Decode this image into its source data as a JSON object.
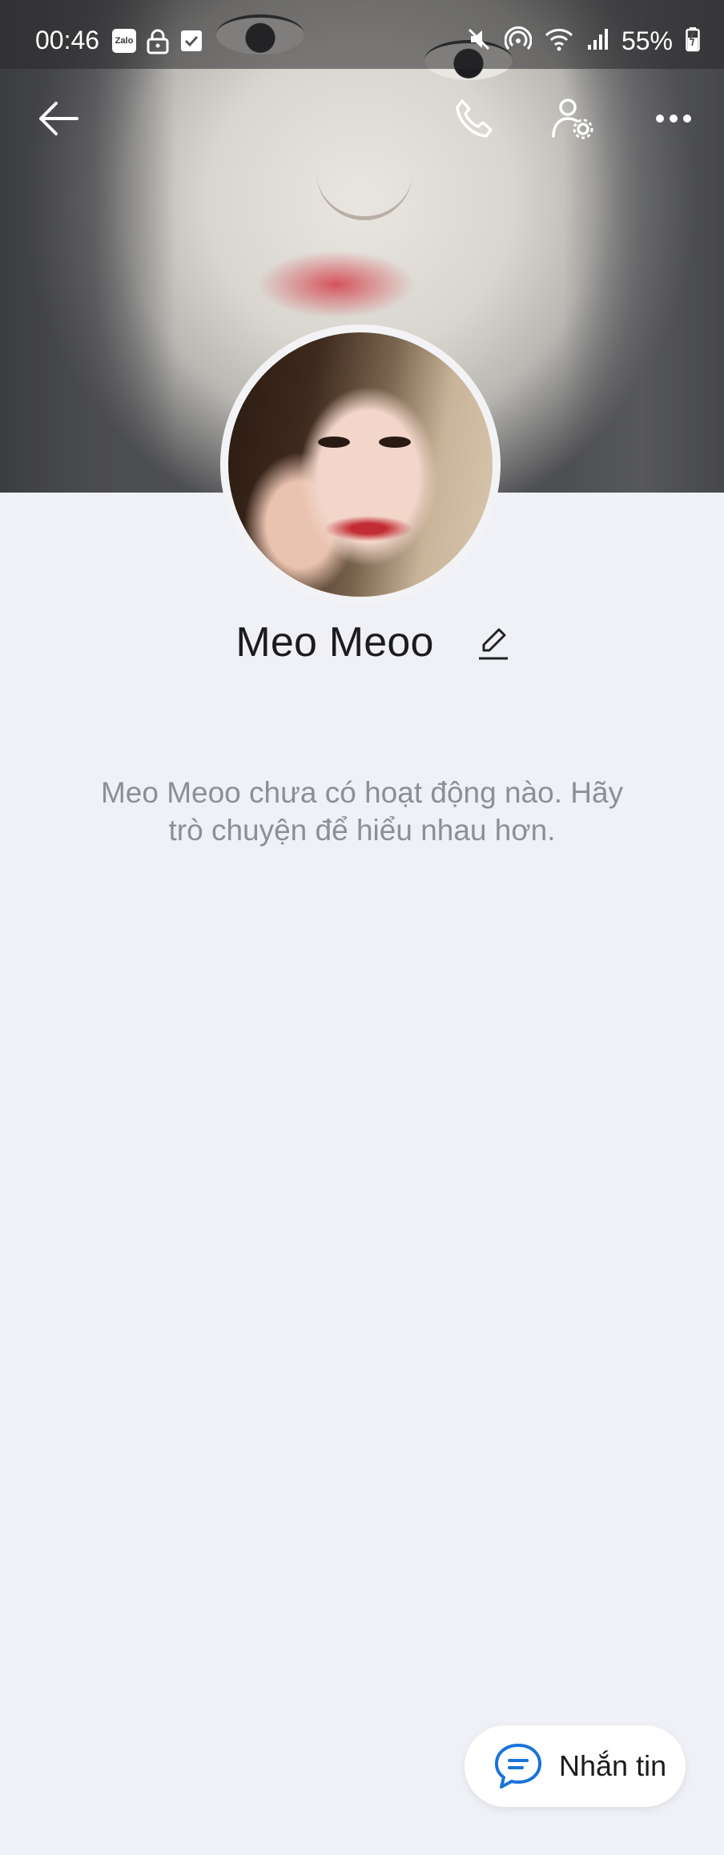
{
  "status_bar": {
    "time": "00:46",
    "left_icons": [
      "zalo-app-icon",
      "lock-icon",
      "checkbox-icon"
    ],
    "zalo_badge": "Zalo",
    "right_icons": [
      "mute-icon",
      "hotspot-icon",
      "wifi-icon",
      "signal-icon"
    ],
    "battery": "55%"
  },
  "top_bar": {
    "icons": [
      "back-arrow-icon",
      "phone-icon",
      "user-settings-icon",
      "more-icon"
    ]
  },
  "profile": {
    "name": "Meo Meoo",
    "edit_icon": "pencil-icon",
    "empty_message": "Meo Meoo chưa có hoạt động nào. Hãy trò chuyện để hiểu nhau hơn."
  },
  "actions": {
    "message_label": "Nhắn tin",
    "message_icon": "chat-bubble-icon",
    "accent_color": "#1a73d9"
  }
}
